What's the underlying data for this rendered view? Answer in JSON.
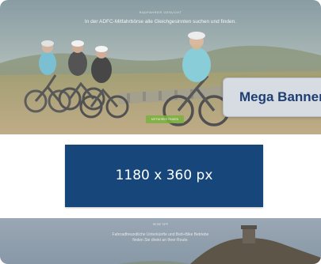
{
  "hero": {
    "kicker": "RADFAHRER GESUCHT",
    "tagline": "In der ADFC-Mitfahrbörse alle Gleichgesinnten suchen und finden.",
    "cta_label": "MITFAHRER FINDEN",
    "colors": {
      "sky": "#8fa3a8",
      "meadow": "#8a8a4e",
      "ground": "#a08a60"
    }
  },
  "banner_tag": {
    "label": "Mega Banner",
    "bg": "#d7dbe2",
    "text_color": "#1e3f73"
  },
  "ad_slot": {
    "size_label": "1180 x 360 px",
    "bg": "#17467a"
  },
  "bottom": {
    "kicker": "REISE TIPP",
    "line1": "Fahrradfreundliche Unterkünfte und Bett+Bike Betriebe",
    "line2": "finden Sie direkt an Ihrer Route."
  }
}
